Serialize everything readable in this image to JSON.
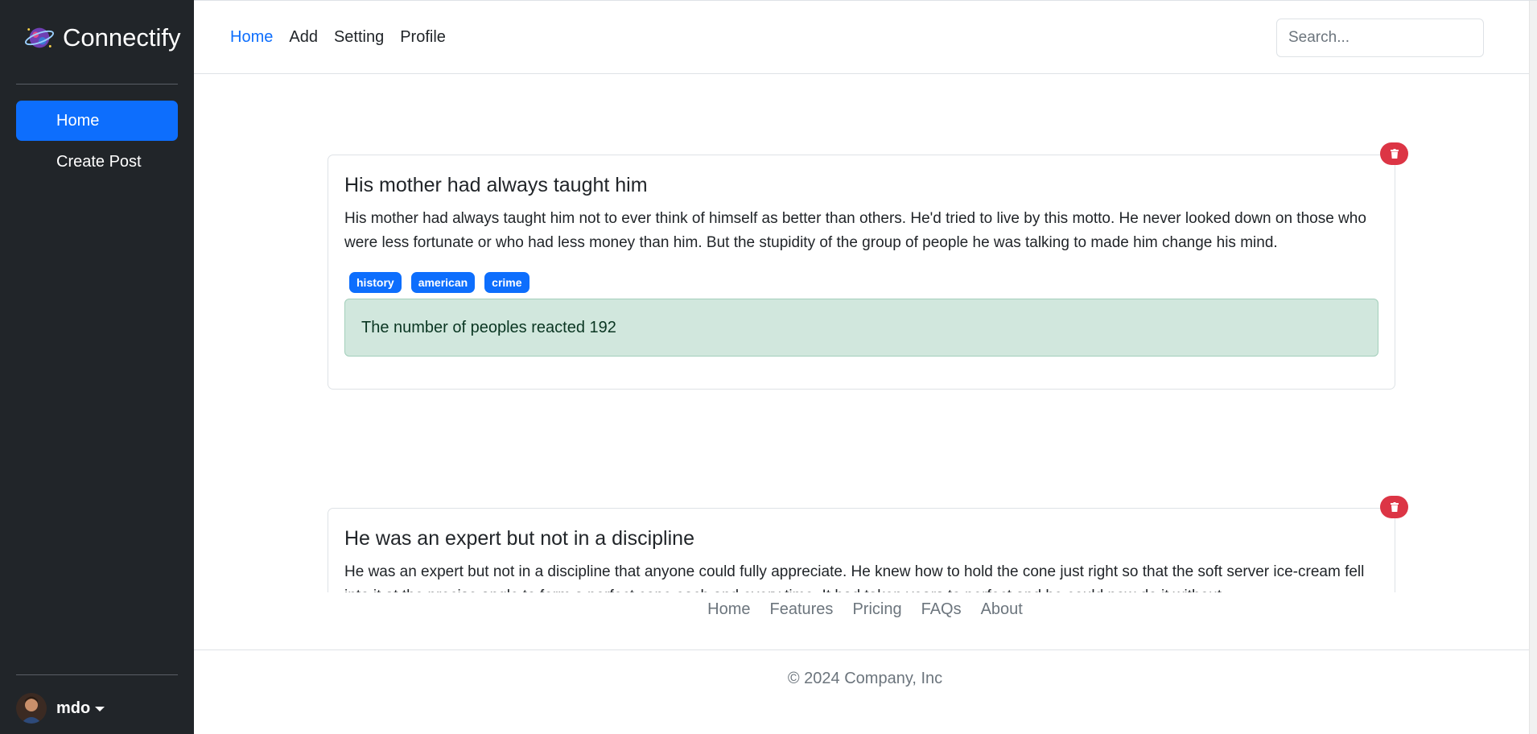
{
  "brand": {
    "name": "Connectify",
    "logo_icon": "planet-logo-icon"
  },
  "sidebar": {
    "items": [
      {
        "label": "Home",
        "active": true
      },
      {
        "label": "Create Post",
        "active": false
      }
    ],
    "user": {
      "name": "mdo",
      "avatar_icon": "user-avatar"
    }
  },
  "topnav": {
    "items": [
      {
        "label": "Home",
        "active": true
      },
      {
        "label": "Add",
        "active": false
      },
      {
        "label": "Setting",
        "active": false
      },
      {
        "label": "Profile",
        "active": false
      }
    ],
    "search_placeholder": "Search..."
  },
  "posts": [
    {
      "title": "His mother had always taught him",
      "body": "His mother had always taught him not to ever think of himself as better than others. He'd tried to live by this motto. He never looked down on those who were less fortunate or who had less money than him. But the stupidity of the group of people he was talking to made him change his mind.",
      "tags": [
        "history",
        "american",
        "crime"
      ],
      "reacted": "The number of peoples reacted 192"
    },
    {
      "title": "He was an expert but not in a discipline",
      "body": "He was an expert but not in a discipline that anyone could fully appreciate. He knew how to hold the cone just right so that the soft server ice-cream fell into it at the precise angle to form a perfect cone each and every time. It had taken years to perfect and he could now do it without"
    }
  ],
  "footer": {
    "links": [
      "Home",
      "Features",
      "Pricing",
      "FAQs",
      "About"
    ],
    "copyright": "© 2024 Company, Inc"
  },
  "colors": {
    "sidebar_bg": "#212529",
    "accent": "#0d6efd",
    "danger": "#dc3545",
    "success_bg": "#d1e7dd"
  }
}
